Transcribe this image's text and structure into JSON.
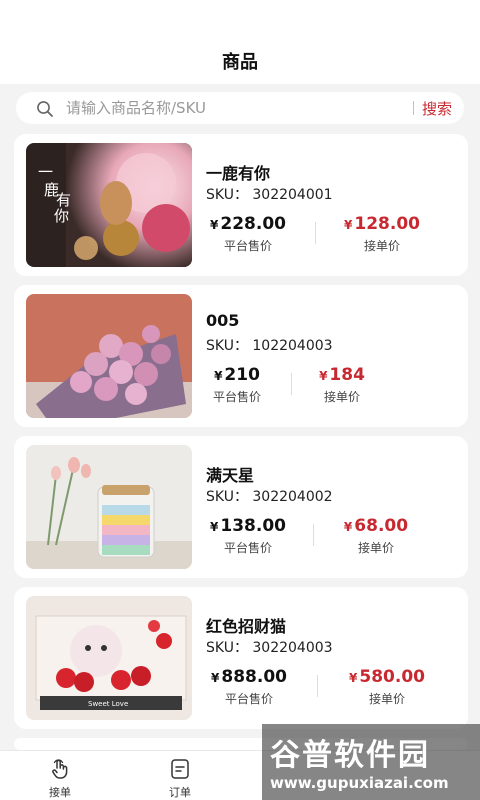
{
  "header": {
    "title": "商品"
  },
  "search": {
    "placeholder": "请输入商品名称/SKU",
    "button_label": "搜索"
  },
  "products": [
    {
      "name": "一鹿有你",
      "sku": "SKU：  302204001",
      "platform_price": "228.00",
      "platform_label": "平台售价",
      "order_price": "128.00",
      "order_label": "接单价",
      "image_text": [
        "一",
        "鹿",
        "有",
        "你"
      ]
    },
    {
      "name": "005",
      "sku": "SKU：  102204003",
      "platform_price": "210",
      "platform_label": "平台售价",
      "order_price": "184",
      "order_label": "接单价"
    },
    {
      "name": "满天星",
      "sku": "SKU：  302204002",
      "platform_price": "138.00",
      "platform_label": "平台售价",
      "order_price": "68.00",
      "order_label": "接单价"
    },
    {
      "name": "红色招财猫",
      "sku": "SKU：  302204003",
      "platform_price": "888.00",
      "platform_label": "平台售价",
      "order_price": "580.00",
      "order_label": "接单价",
      "image_text": [
        "Sweet Love"
      ]
    }
  ],
  "currency_symbol": "¥",
  "tabbar": {
    "tabs": [
      {
        "label": "接单",
        "icon": "hand-tap-icon"
      },
      {
        "label": "订单",
        "icon": "order-list-icon"
      }
    ]
  },
  "watermark": {
    "title": "谷普软件园",
    "url": "www.gupuxiazai.com"
  },
  "colors": {
    "accent": "#c8282f",
    "background": "#f3f3f3"
  }
}
